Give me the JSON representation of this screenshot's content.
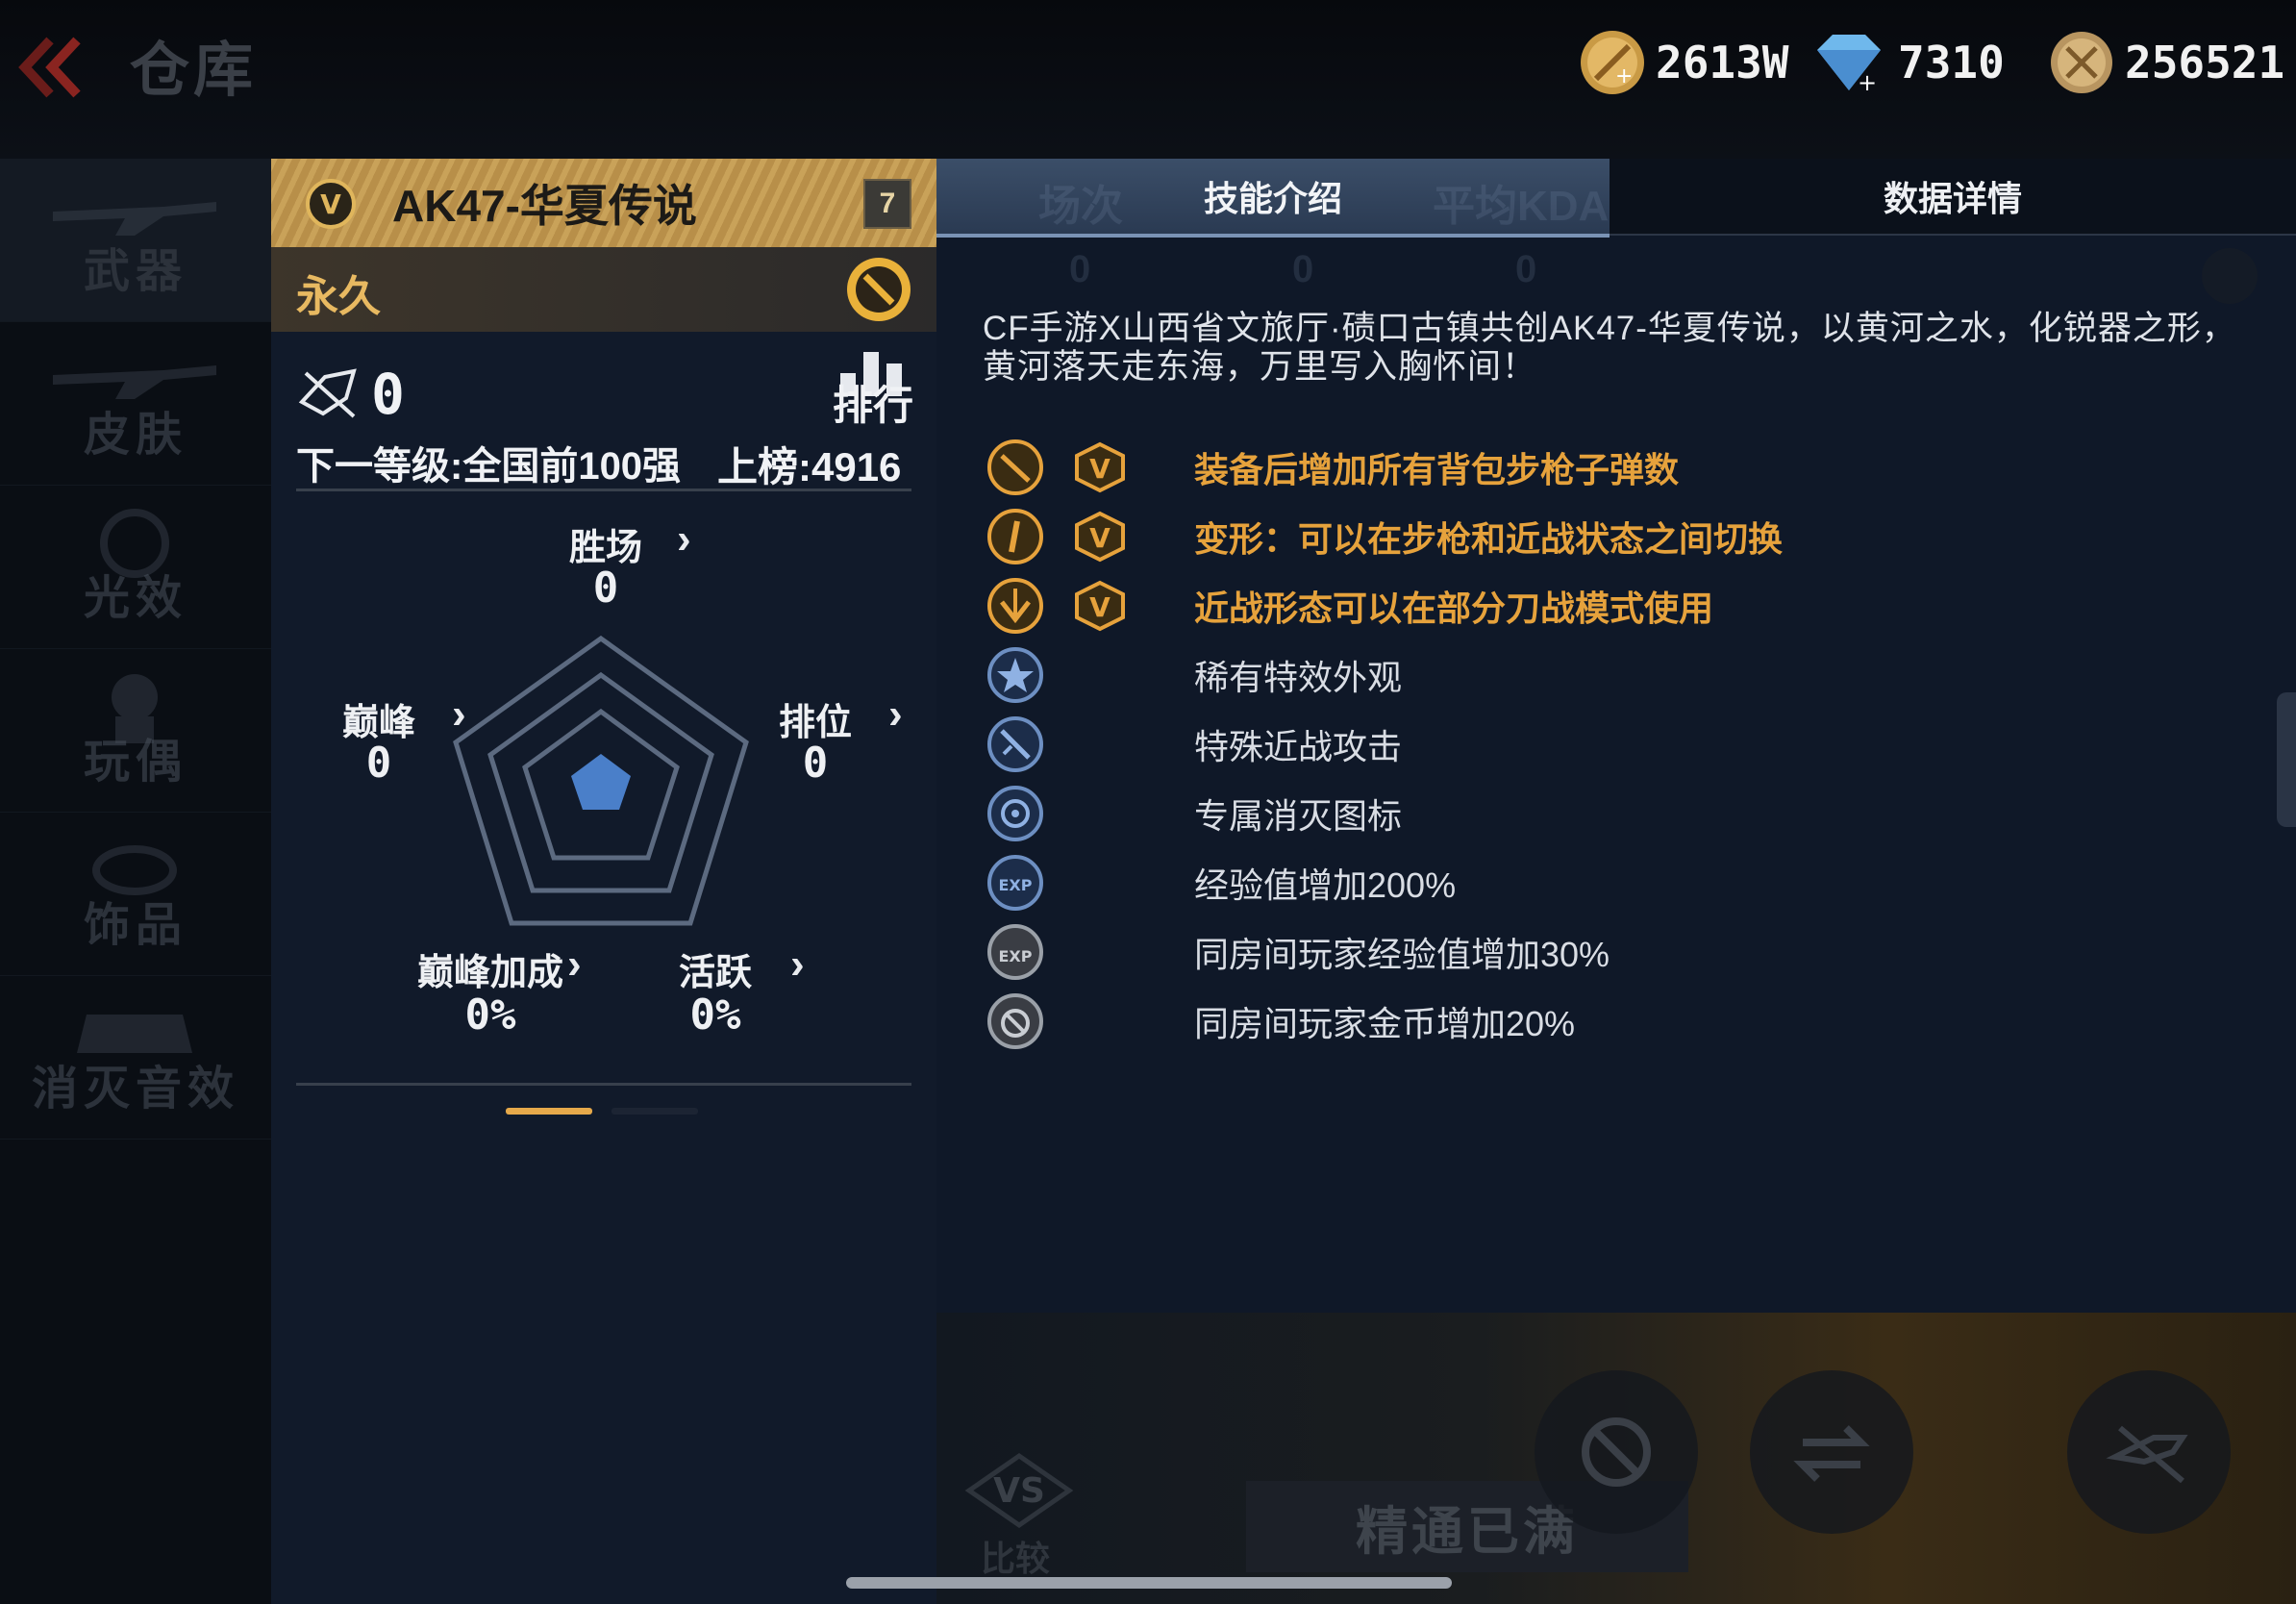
{
  "header": {
    "title": "仓库",
    "currencies": [
      {
        "icon": "gold-coin-icon",
        "value": "2613W"
      },
      {
        "icon": "diamond-icon",
        "value": "7310"
      },
      {
        "icon": "honor-coin-icon",
        "value": "256521"
      }
    ]
  },
  "sidebar": {
    "items": [
      {
        "label": "武器",
        "active": true
      },
      {
        "label": "皮肤"
      },
      {
        "label": "光效"
      },
      {
        "label": "玩偶"
      },
      {
        "label": "饰品"
      },
      {
        "label": "消灭音效"
      }
    ]
  },
  "weapon": {
    "name": "AK47-华夏传说",
    "level_badge": "7",
    "duration": "永久",
    "kills": "0",
    "rank_label": "排行",
    "next_level": "下一等级:全国前100强",
    "on_board": "上榜:4916",
    "radar": {
      "wins_label": "胜场",
      "wins_value": "0",
      "peak_label": "巅峰",
      "peak_value": "0",
      "ranked_label": "排位",
      "ranked_value": "0",
      "peak_bonus_label": "巅峰加成",
      "peak_bonus_value": "0%",
      "active_label": "活跃",
      "active_value": "0%"
    }
  },
  "tabs": {
    "skill": "技能介绍",
    "data": "数据详情",
    "ghost_headers": [
      "场次",
      "平均KDA"
    ],
    "ghost_values": [
      "0",
      "0",
      "0"
    ]
  },
  "description": "CF手游X山西省文旅厅·碛口古镇共创AK47-华夏传说，以黄河之水，化锐器之形，黄河落天走东海，万里写入胸怀间！",
  "skills": [
    {
      "icon": "rifle-ammo-icon",
      "v_badge": true,
      "text": "装备后增加所有背包步枪子弹数",
      "style": "gold"
    },
    {
      "icon": "transform-icon",
      "v_badge": true,
      "text": "变形：可以在步枪和近战状态之间切换",
      "style": "gold"
    },
    {
      "icon": "melee-mode-icon",
      "v_badge": true,
      "text": "近战形态可以在部分刀战模式使用",
      "style": "gold"
    },
    {
      "icon": "star-icon",
      "v_badge": false,
      "text": "稀有特效外观",
      "style": "plain"
    },
    {
      "icon": "melee-attack-icon",
      "v_badge": false,
      "text": "特殊近战攻击",
      "style": "plain"
    },
    {
      "icon": "kill-mark-icon",
      "v_badge": false,
      "text": "专属消灭图标",
      "style": "plain"
    },
    {
      "icon": "exp-icon",
      "v_badge": false,
      "text": "经验值增加200%",
      "style": "plain"
    },
    {
      "icon": "room-exp-icon",
      "v_badge": false,
      "text": "同房间玩家经验值增加30%",
      "style": "plain"
    },
    {
      "icon": "room-coin-icon",
      "v_badge": false,
      "text": "同房间玩家金币增加20%",
      "style": "plain"
    }
  ],
  "bottom": {
    "mastery": "精通已满",
    "compare_vs": "VS",
    "compare_label": "比较"
  },
  "colors": {
    "accent_gold": "#e6a23c",
    "header_gold": "#c9a259",
    "panel_bg": "#0f1828"
  }
}
